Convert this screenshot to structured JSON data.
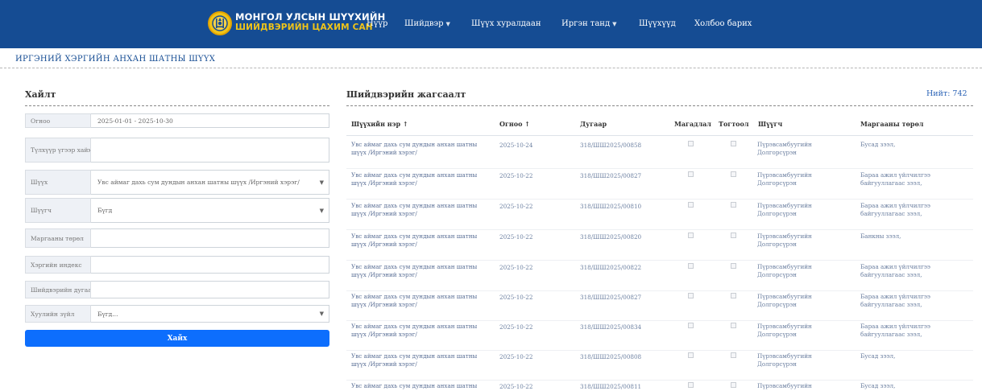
{
  "header": {
    "brand_line1": "МОНГОЛ УЛСЫН ШҮҮХИЙН",
    "brand_line2": "ШИЙДВЭРИЙН ЦАХИМ САН",
    "nav": [
      {
        "label": "Нүүр",
        "dropdown": false
      },
      {
        "label": "Шийдвэр",
        "dropdown": true
      },
      {
        "label": "Шүүх хуралдаан",
        "dropdown": false
      },
      {
        "label": "Иргэн танд",
        "dropdown": true
      },
      {
        "label": "Шүүхүүд",
        "dropdown": false
      },
      {
        "label": "Холбоо барих",
        "dropdown": false
      }
    ],
    "caret": "▼"
  },
  "page_title": "ИРГЭНИЙ ХЭРГИЙН АНХАН ШАТНЫ ШҮҮХ",
  "search": {
    "title": "Хайлт",
    "fields": [
      {
        "label": "Огноо",
        "value": "2025-01-01 - 2025-10-30",
        "type": "text"
      },
      {
        "label": "Түлхүүр үгээр хайх",
        "value": "",
        "type": "text"
      },
      {
        "label": "Шүүх",
        "value": "Увс аймаг дахь сум дундын анхан шатны шүүх /Иргэний хэрэг/",
        "type": "select"
      },
      {
        "label": "Шүүгч",
        "value": "Бүгд",
        "type": "select"
      },
      {
        "label": "Маргааны төрөл",
        "value": "",
        "type": "text"
      },
      {
        "label": "Хэргийн индекс",
        "value": "",
        "type": "text"
      },
      {
        "label": "Шийдвэрийн дугаар",
        "value": "",
        "type": "text"
      },
      {
        "label": "Хуулийн зүйл",
        "value": "Бүгд...",
        "type": "select"
      }
    ],
    "button": "Хайх"
  },
  "results": {
    "title": "Шийдвэрийн жагсаалт",
    "total": "Нийт: 742",
    "columns": [
      "Шүүхийн нэр ↑",
      "Огноо ↑",
      "Дугаар",
      "Магадлал",
      "Тогтоол",
      "Шүүгч",
      "Маргааны төрөл"
    ],
    "rows": [
      {
        "court": "Увс аймаг дахь сум дундын анхан шатны шүүх /Иргэний хэрэг/",
        "date": "2025-10-24",
        "number": "318/ШШ2025/00858",
        "judge": "Пүрэвсамбуугийн Долгорсүрэн",
        "type": "Бусад зээл,"
      },
      {
        "court": "Увс аймаг дахь сум дундын анхан шатны шүүх /Иргэний хэрэг/",
        "date": "2025-10-22",
        "number": "318/ШШ2025/00827",
        "judge": "Пүрэвсамбуугийн Долгорсүрэн",
        "type": "Бараа ажил үйлчилгээ байгууллагаас зээл,"
      },
      {
        "court": "Увс аймаг дахь сум дундын анхан шатны шүүх /Иргэний хэрэг/",
        "date": "2025-10-22",
        "number": "318/ШШ2025/00810",
        "judge": "Пүрэвсамбуугийн Долгорсүрэн",
        "type": "Бараа ажил үйлчилгээ байгууллагаас зээл,"
      },
      {
        "court": "Увс аймаг дахь сум дундын анхан шатны шүүх /Иргэний хэрэг/",
        "date": "2025-10-22",
        "number": "318/ШШ2025/00820",
        "judge": "Пүрэвсамбуугийн Долгорсүрэн",
        "type": "Банкны зээл,"
      },
      {
        "court": "Увс аймаг дахь сум дундын анхан шатны шүүх /Иргэний хэрэг/",
        "date": "2025-10-22",
        "number": "318/ШШ2025/00822",
        "judge": "Пүрэвсамбуугийн Долгорсүрэн",
        "type": "Бараа ажил үйлчилгээ байгууллагаас зээл,"
      },
      {
        "court": "Увс аймаг дахь сум дундын анхан шатны шүүх /Иргэний хэрэг/",
        "date": "2025-10-22",
        "number": "318/ШШ2025/00827",
        "judge": "Пүрэвсамбуугийн Долгорсүрэн",
        "type": "Бараа ажил үйлчилгээ байгууллагаас зээл,"
      },
      {
        "court": "Увс аймаг дахь сум дундын анхан шатны шүүх /Иргэний хэрэг/",
        "date": "2025-10-22",
        "number": "318/ШШ2025/00834",
        "judge": "Пүрэвсамбуугийн Долгорсүрэн",
        "type": "Бараа ажил үйлчилгээ байгууллагаас зээл,"
      },
      {
        "court": "Увс аймаг дахь сум дундын анхан шатны шүүх /Иргэний хэрэг/",
        "date": "2025-10-22",
        "number": "318/ШШ2025/00808",
        "judge": "Пүрэвсамбуугийн Долгорсүрэн",
        "type": "Бусад зээл,"
      },
      {
        "court": "Увс аймаг дахь сум дундын анхан шатны шүүх /Иргэний хэрэг/",
        "date": "2025-10-22",
        "number": "318/ШШ2025/00811",
        "judge": "Пүрэвсамбуугийн Долгорсүрэн",
        "type": "Бусад зээл,"
      }
    ]
  },
  "colors": {
    "header_bg": "#154c93",
    "brand_gold": "#f0c419",
    "link": "#5a6f96",
    "button": "#0d6efd",
    "label_bg": "#eef1f6"
  }
}
